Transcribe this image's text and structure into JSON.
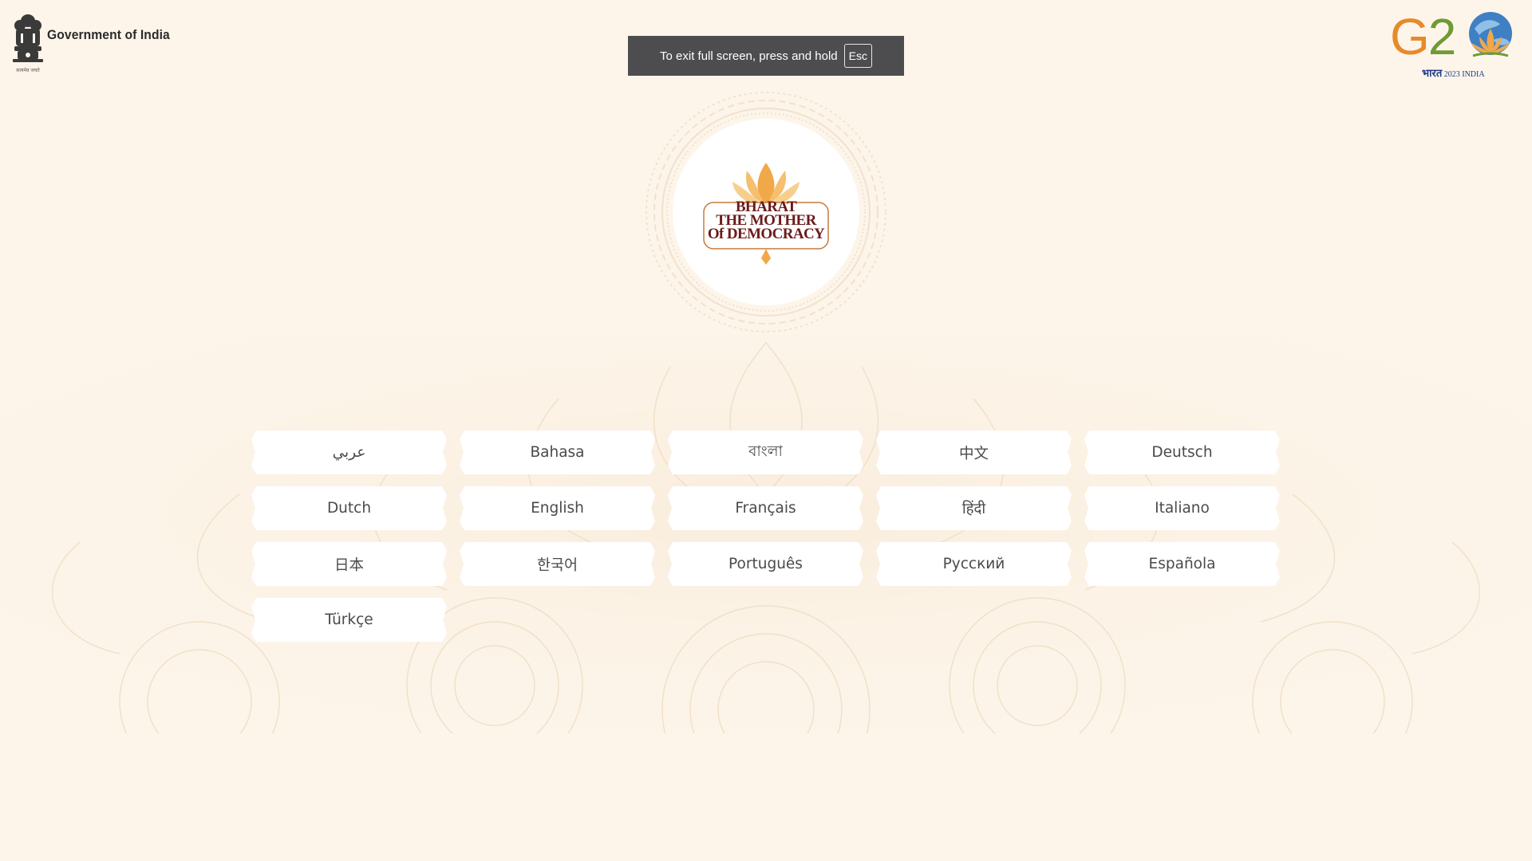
{
  "header": {
    "government_label": "Government of India",
    "emblem_motto": "सत्यमेव जयते",
    "g20_hindi": "भारत",
    "g20_sub": "2023 INDIA",
    "g20_icon": "g20-lotus-globe-icon"
  },
  "fullscreen_notice": {
    "text": "To exit full screen, press and hold",
    "key": "Esc"
  },
  "medallion": {
    "lines": [
      "BHARAT",
      "THE MOTHER",
      "Of DEMOCRACY"
    ],
    "icon": "lotus-icon"
  },
  "languages": [
    {
      "label": "عربي"
    },
    {
      "label": "Bahasa"
    },
    {
      "label": "বাংলা"
    },
    {
      "label": "中文"
    },
    {
      "label": "Deutsch"
    },
    {
      "label": "Dutch"
    },
    {
      "label": "English"
    },
    {
      "label": "Français"
    },
    {
      "label": "हिंदी"
    },
    {
      "label": "Italiano"
    },
    {
      "label": "日本"
    },
    {
      "label": "한국어"
    },
    {
      "label": "Português"
    },
    {
      "label": "Русский"
    },
    {
      "label": "Española"
    },
    {
      "label": "Türkçe"
    }
  ],
  "colors": {
    "background": "#fdf5ea",
    "lotus_orange": "#f0a848",
    "maroon_text": "#6b1a1a",
    "g20_orange": "#e78a2a",
    "g20_green": "#6f9a34",
    "g20_blue": "#1d3a8a"
  }
}
